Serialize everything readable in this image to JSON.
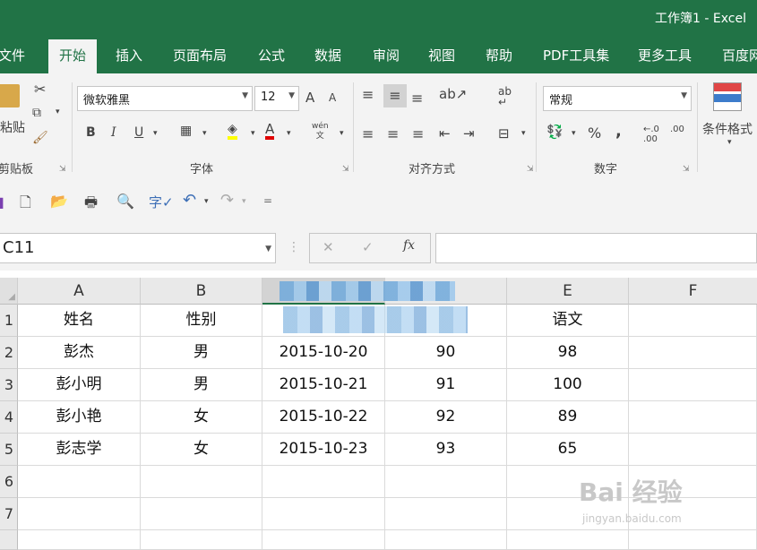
{
  "window": {
    "title": "工作簿1  -  Excel"
  },
  "tabs": [
    "文件",
    "开始",
    "插入",
    "页面布局",
    "公式",
    "数据",
    "审阅",
    "视图",
    "帮助",
    "PDF工具集",
    "更多工具",
    "百度网"
  ],
  "ribbon": {
    "clipboard": {
      "label": "剪贴板",
      "paste": "粘贴"
    },
    "font": {
      "label": "字体",
      "name": "微软雅黑",
      "size": "12",
      "bold": "B",
      "italic": "I",
      "underline": "U",
      "grow": "A",
      "shrink": "A",
      "wen": "wén\n文"
    },
    "alignment": {
      "label": "对齐方式"
    },
    "number": {
      "label": "数字",
      "format": "常规",
      "percent": "%",
      "comma": ",",
      "inc": ".00→.0",
      "dec": ".00"
    },
    "styles": {
      "cond_format": "条件格式"
    }
  },
  "formula_bar": {
    "name_box": "C11",
    "cancel": "✕",
    "enter": "✓",
    "fx": "fx",
    "formula": ""
  },
  "sheet": {
    "columns": [
      "A",
      "B",
      "",
      "",
      "E",
      "F"
    ],
    "rows": [
      "1",
      "2",
      "3",
      "4",
      "5",
      "6",
      "7",
      ""
    ],
    "header_row": [
      "姓名",
      "性别",
      "",
      "",
      "语文",
      ""
    ],
    "data": [
      [
        "彭杰",
        "男",
        "2015-10-20",
        "90",
        "98",
        ""
      ],
      [
        "彭小明",
        "男",
        "2015-10-21",
        "91",
        "100",
        ""
      ],
      [
        "彭小艳",
        "女",
        "2015-10-22",
        "92",
        "89",
        ""
      ],
      [
        "彭志学",
        "女",
        "2015-10-23",
        "93",
        "65",
        ""
      ]
    ]
  },
  "watermark": {
    "brand": "Bai 经验",
    "url": "jingyan.baidu.com"
  }
}
